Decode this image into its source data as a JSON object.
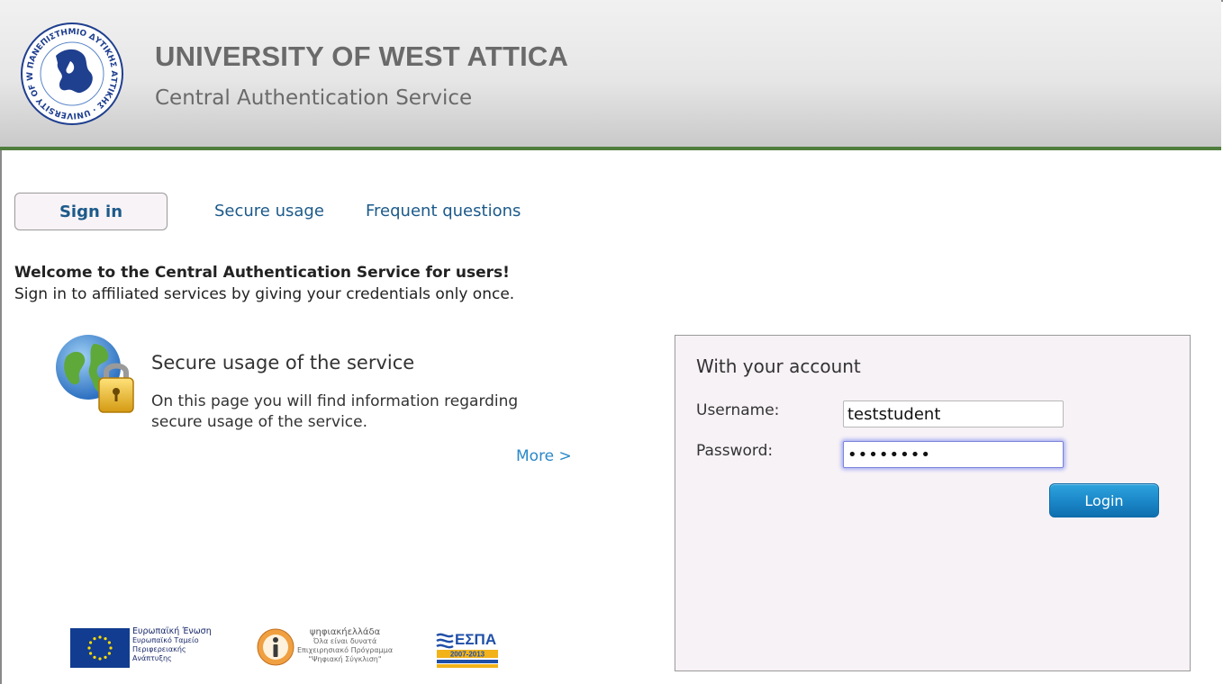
{
  "header": {
    "title": "UNIVERSITY OF WEST ATTICA",
    "subtitle": "Central Authentication Service",
    "seal_text": "ΠΑΝΕΠΙΣΤΗΜΙΟ ΔΥΤΙΚΗΣ ΑΤΤΙΚΗΣ · UNIVERSITY OF WEST ATTICA"
  },
  "tabs": [
    {
      "label": "Sign in",
      "active": true
    },
    {
      "label": "Secure usage",
      "active": false
    },
    {
      "label": "Frequent questions",
      "active": false
    }
  ],
  "welcome": {
    "title": "Welcome to the Central Authentication Service for users!",
    "text": "Sign in to affiliated services by giving your credentials only once."
  },
  "secure_block": {
    "title": "Secure usage of the service",
    "description": "On this page you will find information regarding secure usage of the service.",
    "more_label": "More >"
  },
  "login": {
    "heading": "With your account",
    "username_label": "Username:",
    "username_value": "teststudent",
    "password_label": "Password:",
    "password_masked": "••••••••",
    "button_label": "Login"
  },
  "footer": {
    "eu": [
      "Ευρωπαϊκή Ένωση",
      "Ευρωπαϊκό Ταμείο",
      "Περιφερειακής",
      "Ανάπτυξης"
    ],
    "digital": [
      "ψηφιακήελλάδα",
      "Όλα είναι δυνατά",
      "Επιχειρησιακό Πρόγραμμα",
      "\"Ψηφιακή Σύγκλιση\""
    ],
    "espa": "ΕΣΠΑ 2007-2013"
  },
  "colors": {
    "header_bar": "#4f7d3d",
    "link": "#1c5a8a",
    "more_link": "#2a88c8",
    "button": "#1a86c7"
  },
  "icons": [
    "university-seal-icon",
    "globe-lock-icon",
    "eu-flag-icon",
    "digital-greece-logo-icon",
    "espa-logo-icon"
  ]
}
